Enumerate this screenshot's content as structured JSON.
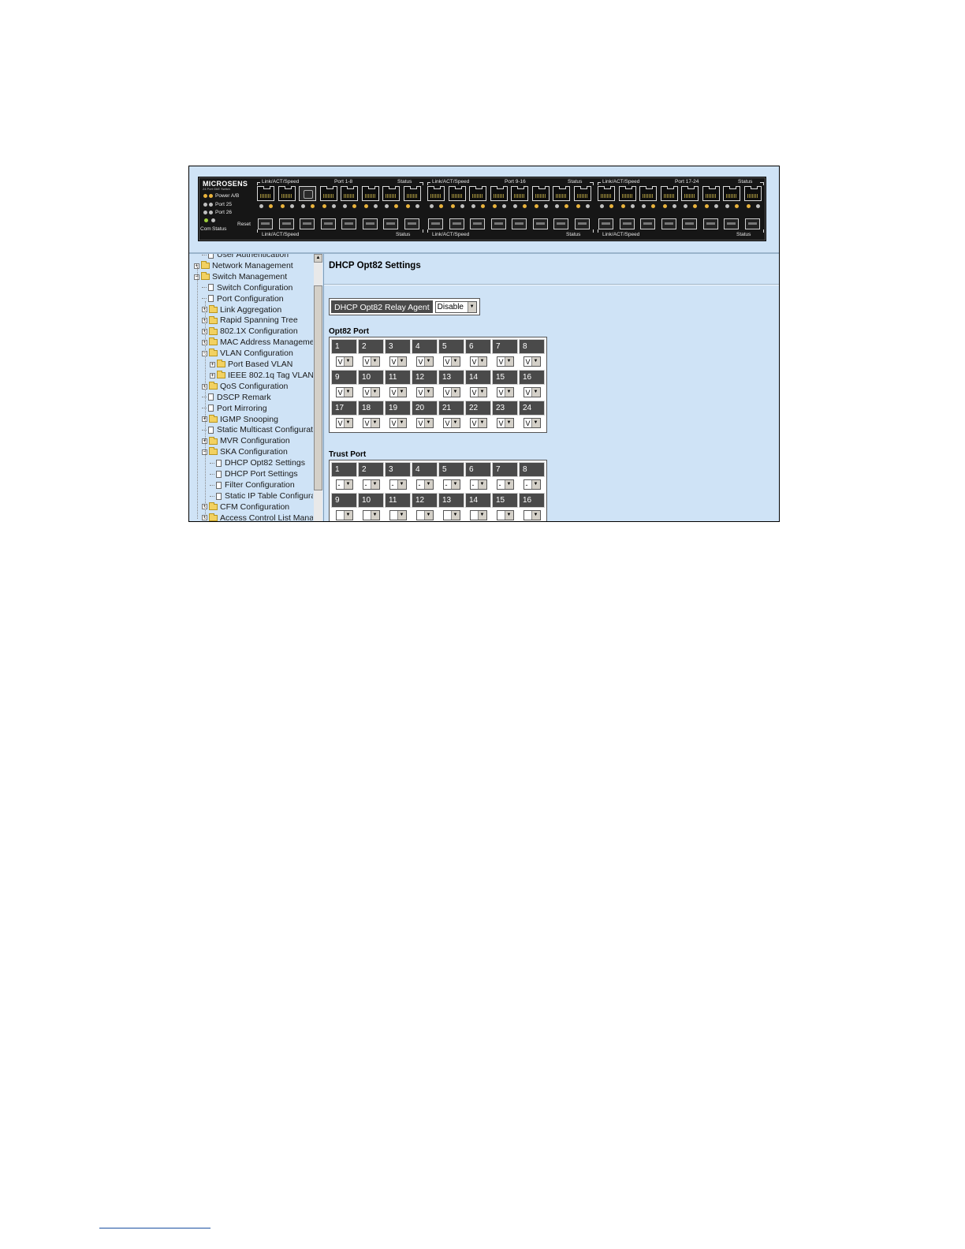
{
  "device": {
    "brand": "MICROSENS",
    "model": "24 Port GbE Switch",
    "labels": {
      "power": "Power A/B",
      "port25": "Port 25",
      "port26": "Port 26",
      "com": "Com",
      "status": "Status",
      "reset": "Reset"
    },
    "groups": [
      {
        "top_left": "Link/ACT/Speed",
        "top_mid": "Port 1-8",
        "top_right": "Status",
        "bottom_left": "Link/ACT/Speed",
        "bottom_right": "Status"
      },
      {
        "top_left": "Link/ACT/Speed",
        "top_mid": "Port 9-16",
        "top_right": "Status",
        "bottom_left": "Link/ACT/Speed",
        "bottom_right": "Status"
      },
      {
        "top_left": "Link/ACT/Speed",
        "top_mid": "Port 17-24",
        "top_right": "Status",
        "bottom_left": "Link/ACT/Speed",
        "bottom_right": "Status"
      }
    ]
  },
  "sidebar": {
    "items": [
      {
        "label": "User Authentication",
        "level": 1,
        "kind": "page"
      },
      {
        "label": "Network Management",
        "level": 0,
        "kind": "folder",
        "expander": "+"
      },
      {
        "label": "Switch Management",
        "level": 0,
        "kind": "folder",
        "expander": "−"
      },
      {
        "label": "Switch Configuration",
        "level": 1,
        "kind": "page"
      },
      {
        "label": "Port Configuration",
        "level": 1,
        "kind": "page"
      },
      {
        "label": "Link Aggregation",
        "level": 1,
        "kind": "folder",
        "expander": "+"
      },
      {
        "label": "Rapid Spanning Tree",
        "level": 1,
        "kind": "folder",
        "expander": "+"
      },
      {
        "label": "802.1X Configuration",
        "level": 1,
        "kind": "folder",
        "expander": "+"
      },
      {
        "label": "MAC Address Managemen",
        "level": 1,
        "kind": "folder",
        "expander": "+"
      },
      {
        "label": "VLAN Configuration",
        "level": 1,
        "kind": "folder",
        "expander": "−"
      },
      {
        "label": "Port Based VLAN",
        "level": 2,
        "kind": "folder",
        "expander": "+"
      },
      {
        "label": "IEEE 802.1q Tag VLAN",
        "level": 2,
        "kind": "folder",
        "expander": "+"
      },
      {
        "label": "QoS Configuration",
        "level": 1,
        "kind": "folder",
        "expander": "+"
      },
      {
        "label": "DSCP Remark",
        "level": 1,
        "kind": "page"
      },
      {
        "label": "Port Mirroring",
        "level": 1,
        "kind": "page"
      },
      {
        "label": "IGMP Snooping",
        "level": 1,
        "kind": "folder",
        "expander": "+"
      },
      {
        "label": "Static Multicast Configuratio",
        "level": 1,
        "kind": "page"
      },
      {
        "label": "MVR Configuration",
        "level": 1,
        "kind": "folder",
        "expander": "+"
      },
      {
        "label": "SKA Configuration",
        "level": 1,
        "kind": "folder",
        "expander": "−"
      },
      {
        "label": "DHCP Opt82 Settings",
        "level": 2,
        "kind": "page"
      },
      {
        "label": "DHCP Port Settings",
        "level": 2,
        "kind": "page"
      },
      {
        "label": "Filter Configuration",
        "level": 2,
        "kind": "page"
      },
      {
        "label": "Static IP Table Configurat",
        "level": 2,
        "kind": "page"
      },
      {
        "label": "CFM Configuration",
        "level": 1,
        "kind": "folder",
        "expander": "+"
      },
      {
        "label": "Access Control List Manage",
        "level": 1,
        "kind": "folder",
        "expander": "+"
      }
    ]
  },
  "main": {
    "title": "DHCP Opt82 Settings",
    "relay_label": "DHCP Opt82 Relay Agent",
    "relay_value": "Disable",
    "opt82_label": "Opt82 Port",
    "opt82_rows": [
      {
        "ports": [
          "1",
          "2",
          "3",
          "4",
          "5",
          "6",
          "7",
          "8"
        ],
        "values": [
          "V",
          "V",
          "V",
          "V",
          "V",
          "V",
          "V",
          "V"
        ]
      },
      {
        "ports": [
          "9",
          "10",
          "11",
          "12",
          "13",
          "14",
          "15",
          "16"
        ],
        "values": [
          "V",
          "V",
          "V",
          "V",
          "V",
          "V",
          "V",
          "V"
        ]
      },
      {
        "ports": [
          "17",
          "18",
          "19",
          "20",
          "21",
          "22",
          "23",
          "24"
        ],
        "values": [
          "V",
          "V",
          "V",
          "V",
          "V",
          "V",
          "V",
          "V"
        ]
      }
    ],
    "trust_label": "Trust Port",
    "trust_rows": [
      {
        "ports": [
          "1",
          "2",
          "3",
          "4",
          "5",
          "6",
          "7",
          "8"
        ],
        "values": [
          "-",
          "-",
          "-",
          "-",
          "-",
          "-",
          "-",
          "-"
        ]
      },
      {
        "ports": [
          "9",
          "10",
          "11",
          "12",
          "13",
          "14",
          "15",
          "16"
        ],
        "values": [
          "",
          "",
          "",
          "",
          "",
          "",
          "",
          ""
        ]
      }
    ]
  },
  "icons": {
    "expander_plus": "plus-box-icon",
    "expander_minus": "minus-box-icon",
    "folder": "folder-icon",
    "page": "page-icon",
    "dropdown_arrow": "▼"
  }
}
